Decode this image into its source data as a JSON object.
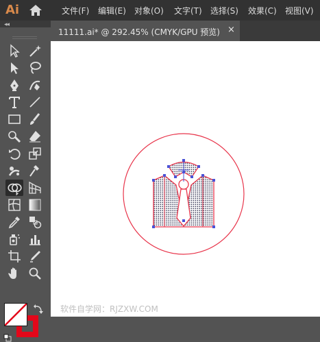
{
  "app": {
    "logo": "Ai"
  },
  "menu": {
    "file": "文件(F)",
    "edit": "编辑(E)",
    "object": "对象(O)",
    "type": "文字(T)",
    "select": "选择(S)",
    "effect": "效果(C)",
    "view": "视图(V)"
  },
  "tabrow": {
    "collapse": "◂◂"
  },
  "document": {
    "title": "11111.ai* @ 292.45% (CMYK/GPU 预览)",
    "close": "×"
  },
  "tools": [
    "selection-tool",
    "direct-selection-tool",
    "pen-tool",
    "curvature-tool",
    "type-tool",
    "line-segment-tool",
    "rectangle-tool",
    "paintbrush-tool",
    "shaper-tool",
    "eraser-tool",
    "rotate-tool",
    "scale-tool",
    "puppet-warp-tool",
    "free-transform-tool",
    "shape-builder-tool",
    "perspective-grid-tool",
    "mesh-tool",
    "gradient-tool",
    "eyedropper-tool",
    "blend-tool",
    "symbol-sprayer-tool",
    "column-graph-tool",
    "artboard-tool",
    "slice-tool",
    "hand-tool",
    "zoom-tool"
  ],
  "colors": {
    "fill": "#ffffff",
    "stroke": "#e3071a",
    "artwork_stroke": "#e8344a",
    "selection": "#4a52d6"
  },
  "canvas": {
    "watermark": "软件自学网：RJZXW.COM"
  }
}
